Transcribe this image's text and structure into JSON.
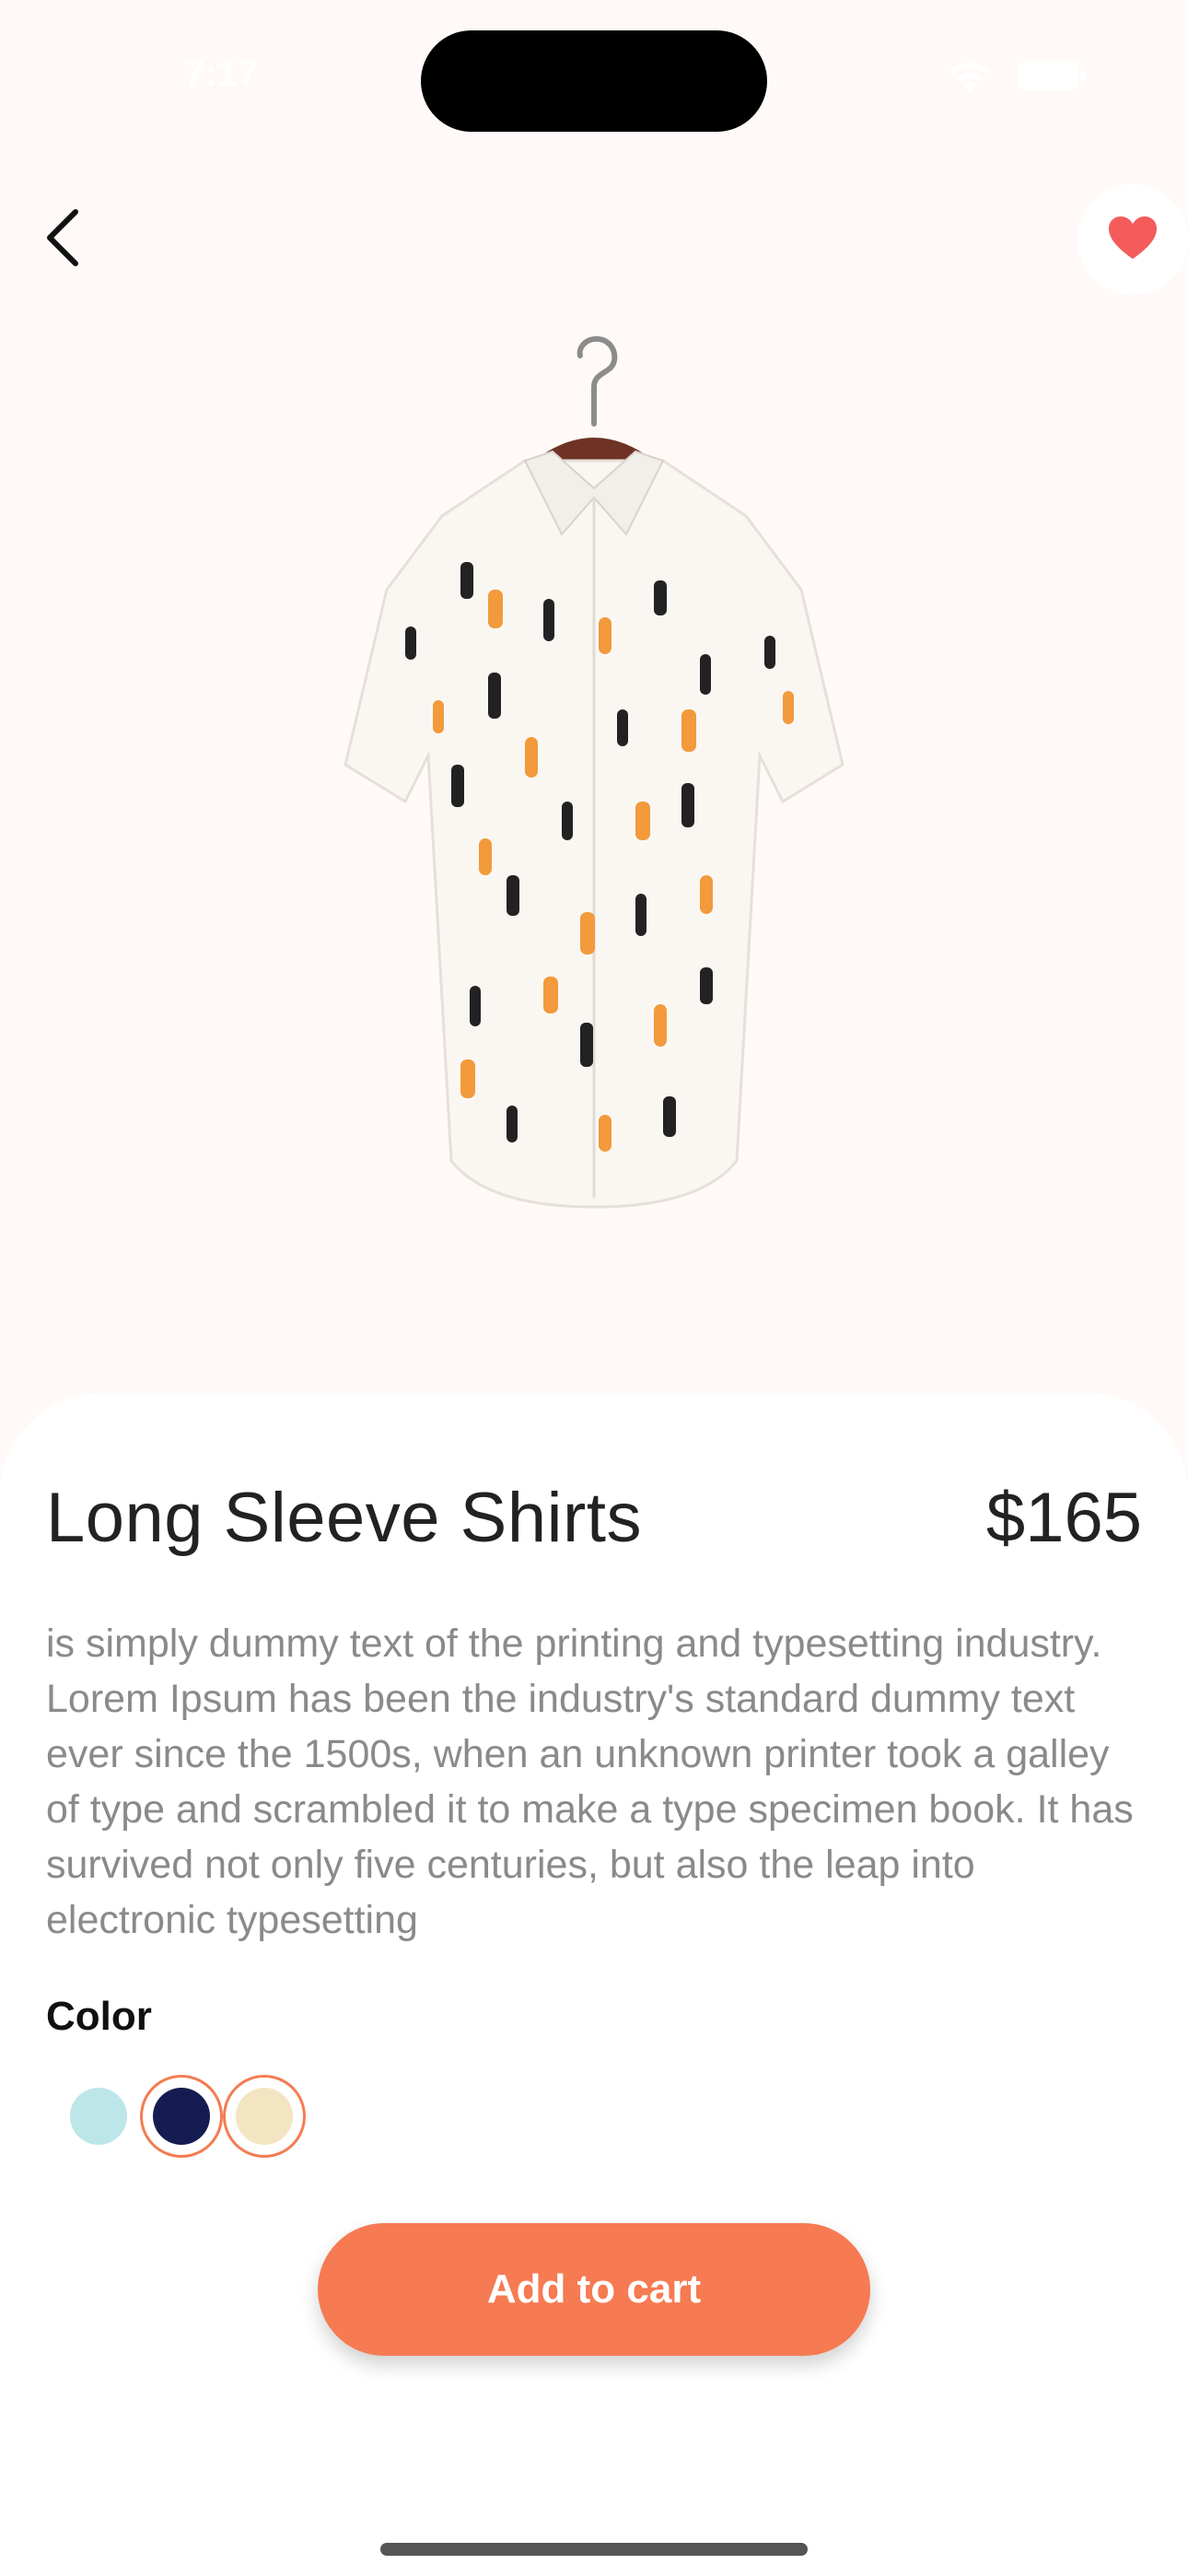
{
  "status_bar": {
    "time": "7:17"
  },
  "icons": {
    "back": "chevron-left-icon",
    "favorite": "heart-icon",
    "wifi": "wifi-icon",
    "battery": "battery-icon"
  },
  "product": {
    "title": "Long Sleeve Shirts",
    "price": "$165",
    "description": "is simply dummy text of the printing and typesetting industry. Lorem Ipsum has been the industry's standard dummy text ever since the 1500s, when an unknown printer took a galley of type and scrambled it to make a type specimen book. It has survived not only five centuries, but also the leap into electronic typesetting",
    "color_label": "Color",
    "colors": [
      {
        "hex": "#bde6e8",
        "selected": false
      },
      {
        "hex": "#141c52",
        "selected": true
      },
      {
        "hex": "#f3e5c2",
        "selected": true
      }
    ]
  },
  "actions": {
    "add_to_cart": "Add to cart"
  },
  "theme": {
    "accent": "#f67a52",
    "heart": "#f45b5b",
    "background": "#fffaf8"
  }
}
